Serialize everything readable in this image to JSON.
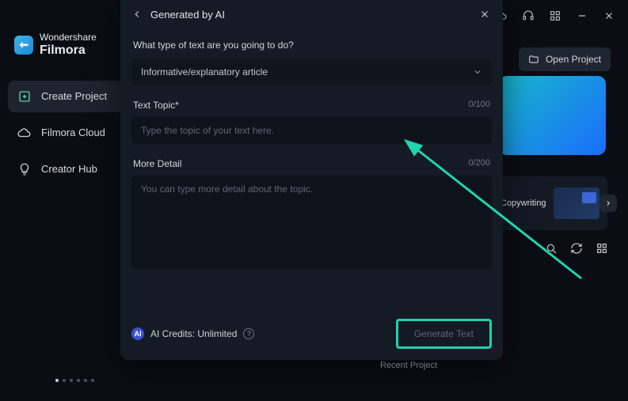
{
  "titlebar": {
    "icons": [
      "cloud",
      "headset",
      "grid",
      "minimize",
      "close"
    ]
  },
  "brand": {
    "top": "Wondershare",
    "name": "Filmora"
  },
  "sidebar": {
    "items": [
      {
        "icon": "plus-box",
        "label": "Create Project",
        "active": true
      },
      {
        "icon": "cloud",
        "label": "Filmora Cloud",
        "active": false
      },
      {
        "icon": "bulb",
        "label": "Creator Hub",
        "active": false
      }
    ]
  },
  "content": {
    "open_project": "Open Project",
    "copywriting_label": "Copywriting",
    "recent_heading": "Recent Project"
  },
  "modal": {
    "title": "Generated by AI",
    "q_type": "What type of text are you going to do?",
    "type_value": "Informative/explanatory article",
    "topic_label": "Text Topic*",
    "topic_counter": "0/100",
    "topic_placeholder": "Type the topic of your text here.",
    "detail_label": "More Detail",
    "detail_counter": "0/200",
    "detail_placeholder": "You can type more detail about the topic.",
    "credits": "AI Credits: Unlimited",
    "credits_badge": "AI",
    "generate": "Generate Text"
  }
}
